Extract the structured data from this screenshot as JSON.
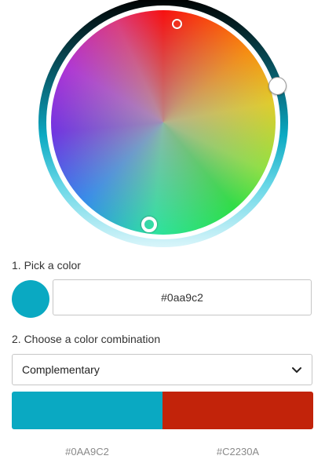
{
  "picker": {
    "selected_hex": "#0aa9c2",
    "handles": {
      "hue_marker": "hue-selection",
      "base_marker": "base-color-selection",
      "lightness_marker": "lightness-slider"
    }
  },
  "step1": {
    "label": "1. Pick a color",
    "hex_value": "#0aa9c2"
  },
  "step2": {
    "label": "2. Choose a color combination",
    "selected_option": "Complementary"
  },
  "palette": {
    "colors": [
      {
        "hex": "#0AA9C2",
        "label": "#0AA9C2"
      },
      {
        "hex": "#C2230A",
        "label": "#C2230A"
      }
    ]
  },
  "icons": {
    "dropdown": "chevron-down-icon"
  }
}
